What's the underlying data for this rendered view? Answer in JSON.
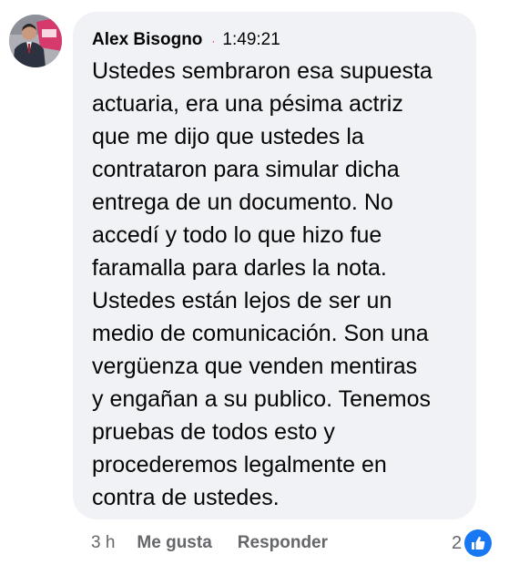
{
  "comment": {
    "author": "Alex Bisogno",
    "separator": "·",
    "timestamp": "1:49:21",
    "lines": [
      "Ustedes sembraron esa supuesta",
      "actuaria, era una pésima actriz",
      "que me dijo que ustedes la",
      "contrataron para simular dicha",
      "entrega de un documento. No",
      "accedí y todo lo que hizo fue",
      "faramalla para darles la nota.",
      "Ustedes están lejos de ser un",
      "medio de comunicación. Son una",
      "vergüenza que venden mentiras",
      "y engañan a su publico. Tenemos",
      "pruebas de todos esto y",
      "procederemos legalmente en",
      "contra de ustedes."
    ]
  },
  "actions": {
    "age": "3 h",
    "like_label": "Me gusta",
    "reply_label": "Responder"
  },
  "reactions": {
    "count": "2",
    "icon": "thumbs-up-icon"
  },
  "colors": {
    "bubble": "#f0f2f5",
    "secondary_text": "#65676b",
    "like_blue": "#1877f2",
    "separator_dot": "#e4173d"
  }
}
